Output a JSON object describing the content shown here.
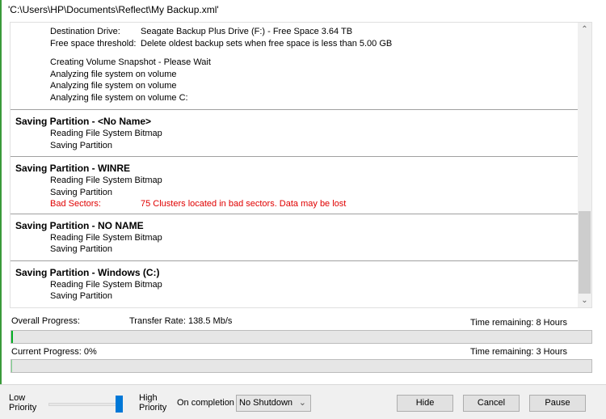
{
  "title": "'C:\\Users\\HP\\Documents\\Reflect\\My Backup.xml'",
  "log": {
    "header": [
      {
        "key": "Destination Drive:",
        "value": "Seagate Backup Plus Drive (F:) - Free Space 3.64 TB"
      },
      {
        "key": "Free space threshold:",
        "value": "Delete oldest backup sets when free space is less than 5.00 GB"
      }
    ],
    "snapshot": [
      "Creating Volume Snapshot - Please Wait",
      "Analyzing file system on volume",
      "Analyzing file system on volume",
      "Analyzing file system on volume C:"
    ],
    "sections": [
      {
        "title": "Saving Partition - <No Name>",
        "lines": [
          "Reading File System Bitmap",
          "Saving Partition"
        ]
      },
      {
        "title": "Saving Partition - WINRE",
        "lines": [
          "Reading File System Bitmap",
          "Saving Partition"
        ],
        "error": {
          "key": "Bad Sectors:",
          "value": "75 Clusters located in bad sectors. Data may be lost"
        }
      },
      {
        "title": "Saving Partition - NO NAME",
        "lines": [
          "Reading File System Bitmap",
          "Saving Partition"
        ]
      },
      {
        "title": "Saving Partition - Windows (C:)",
        "lines": [
          "Reading File System Bitmap",
          "Saving Partition"
        ]
      }
    ]
  },
  "progress": {
    "overall_label": "Overall Progress:",
    "transfer_rate": "Transfer Rate: 138.5 Mb/s",
    "overall_remaining": "Time remaining: 8 Hours",
    "overall_percent": 0.3,
    "current_label": "Current Progress:  0%",
    "current_remaining": "Time remaining: 3 Hours",
    "current_percent": 0
  },
  "footer": {
    "low": "Low",
    "low2": "Priority",
    "high": "High",
    "high2": "Priority",
    "priority_level": 1.0,
    "on_completion": "On completion",
    "completion_value": "No Shutdown",
    "hide": "Hide",
    "cancel": "Cancel",
    "pause": "Pause"
  },
  "colors": {
    "progress": "#06b025",
    "error": "#e00000",
    "slider": "#0078d7"
  }
}
